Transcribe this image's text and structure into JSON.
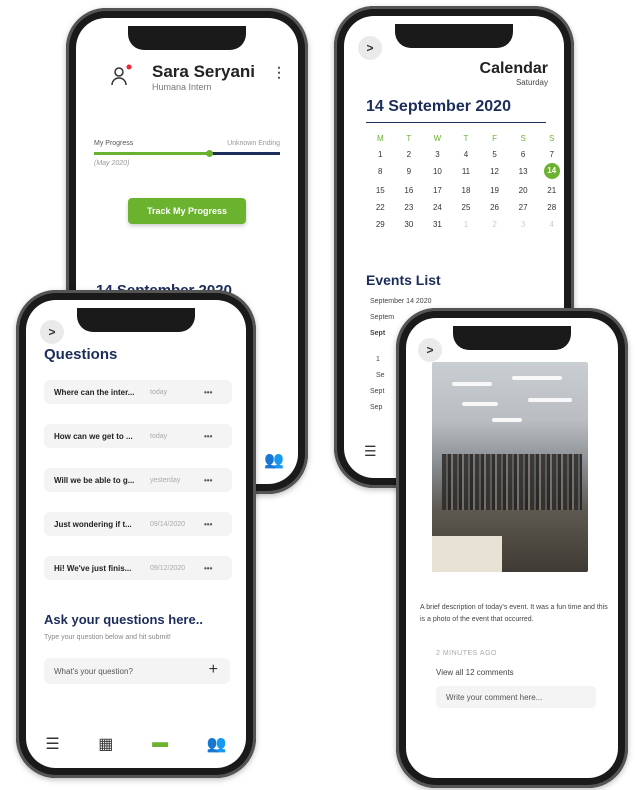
{
  "profile": {
    "name": "Sara Seryani",
    "role": "Humana Intern",
    "progress_label": "My Progress",
    "progress_right": "Unknown Ending",
    "progress_fraction": 0.62,
    "progress_date": "(May 2020)",
    "track_button": "Track My Progress",
    "date": "14 September 2020"
  },
  "calendar": {
    "back": ">",
    "title": "Calendar",
    "weekday": "Saturday",
    "date": "14 September 2020",
    "week_headers": [
      "M",
      "T",
      "W",
      "T",
      "F",
      "S",
      "S"
    ],
    "days": [
      "1",
      "2",
      "3",
      "4",
      "5",
      "6",
      "7",
      "8",
      "9",
      "10",
      "11",
      "12",
      "13",
      "14",
      "15",
      "16",
      "17",
      "18",
      "19",
      "20",
      "21",
      "22",
      "23",
      "24",
      "25",
      "26",
      "27",
      "28",
      "29",
      "30",
      "31",
      "1",
      "2",
      "3",
      "4"
    ],
    "today": "14",
    "events_title": "Events List",
    "events": [
      "September 14 2020",
      "Septem",
      "Sept",
      "1",
      "Se",
      "Sept",
      "Sep"
    ]
  },
  "questions": {
    "back": ">",
    "title": "Questions",
    "items": [
      {
        "text": "Where can the inter...",
        "time": "today"
      },
      {
        "text": "How can we get to ...",
        "time": "today"
      },
      {
        "text": "Will we be able to g...",
        "time": "yesterday"
      },
      {
        "text": "Just wondering if t...",
        "time": "09/14/2020"
      },
      {
        "text": "Hi! We've just finis...",
        "time": "09/12/2020"
      }
    ],
    "more": "•••",
    "ask_title": "Ask your questions here..",
    "ask_sub": "Type your question below and hit submit!",
    "input_placeholder": "What's your question?",
    "plus": "+"
  },
  "event_detail": {
    "back": ">",
    "description": "A brief description of today's event. It was a fun time and this is a photo of the event that occurred.",
    "ago": "2 MINUTES AGO",
    "view_all": "View all 12 comments",
    "comment_placeholder": "Write your comment here..."
  },
  "tabs": {
    "icons": [
      "checklist-icon",
      "calendar-icon",
      "chat-icon",
      "people-icon"
    ],
    "glyphs": [
      "☰",
      "▦",
      "▬",
      "👥"
    ]
  },
  "colors": {
    "accent": "#6bb32e",
    "navy": "#1c2d5a"
  }
}
